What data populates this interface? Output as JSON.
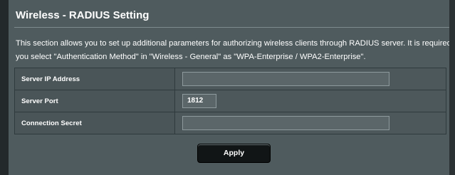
{
  "section": {
    "title": "Wireless - RADIUS Setting",
    "description_line1": "This section allows you to set up additional parameters for authorizing wireless clients through RADIUS server. It is required while",
    "description_line2": "you select \"Authentication Method\" in \"Wireless - General\" as \"WPA-Enterprise / WPA2-Enterprise\"."
  },
  "form": {
    "server_ip": {
      "label": "Server IP Address",
      "value": ""
    },
    "server_port": {
      "label": "Server Port",
      "value": "1812"
    },
    "connection_secret": {
      "label": "Connection Secret",
      "value": ""
    }
  },
  "actions": {
    "apply_label": "Apply"
  }
}
